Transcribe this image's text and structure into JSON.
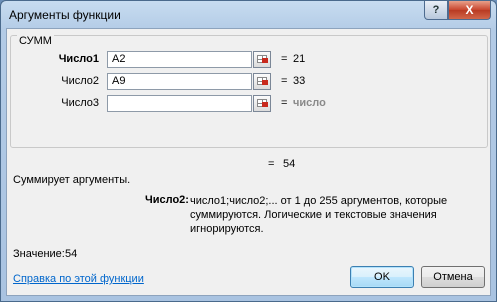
{
  "window": {
    "title": "Аргументы функции",
    "help_label": "?",
    "close_label": "X"
  },
  "function_group": {
    "name": "СУММ",
    "arguments": [
      {
        "label": "Число1",
        "value": "A2",
        "result": "21",
        "bold": true
      },
      {
        "label": "Число2",
        "value": "A9",
        "result": "33",
        "bold": false
      },
      {
        "label": "Число3",
        "value": "",
        "result": "число",
        "bold": false
      }
    ],
    "equals": "="
  },
  "overall_result": {
    "equals": "=",
    "value": "54"
  },
  "description": "Суммирует аргументы.",
  "argument_help": {
    "label": "Число2:",
    "text": "число1;число2;... от 1 до 255 аргументов, которые суммируются. Логические и текстовые значения игнорируются."
  },
  "value_row": {
    "label": "Значение:",
    "value": "54"
  },
  "help_link": "Справка по этой функции",
  "buttons": {
    "ok": "OK",
    "cancel": "Отмена"
  },
  "icons": {
    "ref": "collapse-dialog-icon"
  }
}
